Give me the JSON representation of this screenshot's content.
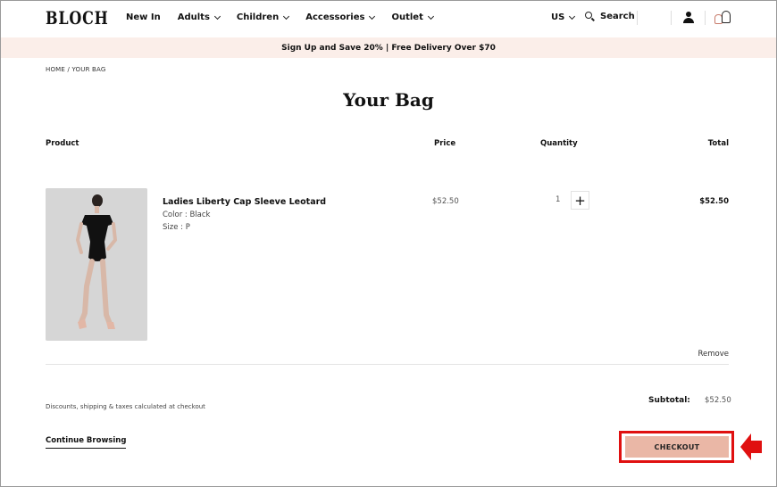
{
  "header": {
    "logo": "BLOCH",
    "nav": [
      {
        "label": "New In",
        "has_dropdown": false
      },
      {
        "label": "Adults",
        "has_dropdown": true
      },
      {
        "label": "Children",
        "has_dropdown": true
      },
      {
        "label": "Accessories",
        "has_dropdown": true
      },
      {
        "label": "Outlet",
        "has_dropdown": true
      }
    ],
    "region": "US",
    "search_label": "Search",
    "icons": [
      "chevron-down-icon",
      "search-icon",
      "account-icon",
      "bag-icon"
    ]
  },
  "promo": {
    "text": "Sign Up and Save 20% | Free Delivery Over $70"
  },
  "breadcrumb": {
    "text": "HOME / YOUR BAG"
  },
  "page": {
    "title": "Your Bag"
  },
  "table": {
    "columns": {
      "product": "Product",
      "price": "Price",
      "quantity": "Quantity",
      "total": "Total"
    }
  },
  "cart": {
    "items": [
      {
        "name": "Ladies Liberty Cap Sleeve Leotard",
        "color": "Color : Black",
        "size": "Size : P",
        "price": "$52.50",
        "quantity": "1",
        "plus": "+",
        "total": "$52.50",
        "remove": "Remove"
      }
    ]
  },
  "summary": {
    "note": "Discounts, shipping & taxes calculated at checkout",
    "subtotal_label": "Subtotal:",
    "subtotal_value": "$52.50"
  },
  "actions": {
    "continue": "Continue Browsing",
    "checkout": "CHECKOUT"
  },
  "colors": {
    "promo_bg": "#fbeee9",
    "checkout_bg": "#eab7a6",
    "highlight": "#e01010"
  }
}
